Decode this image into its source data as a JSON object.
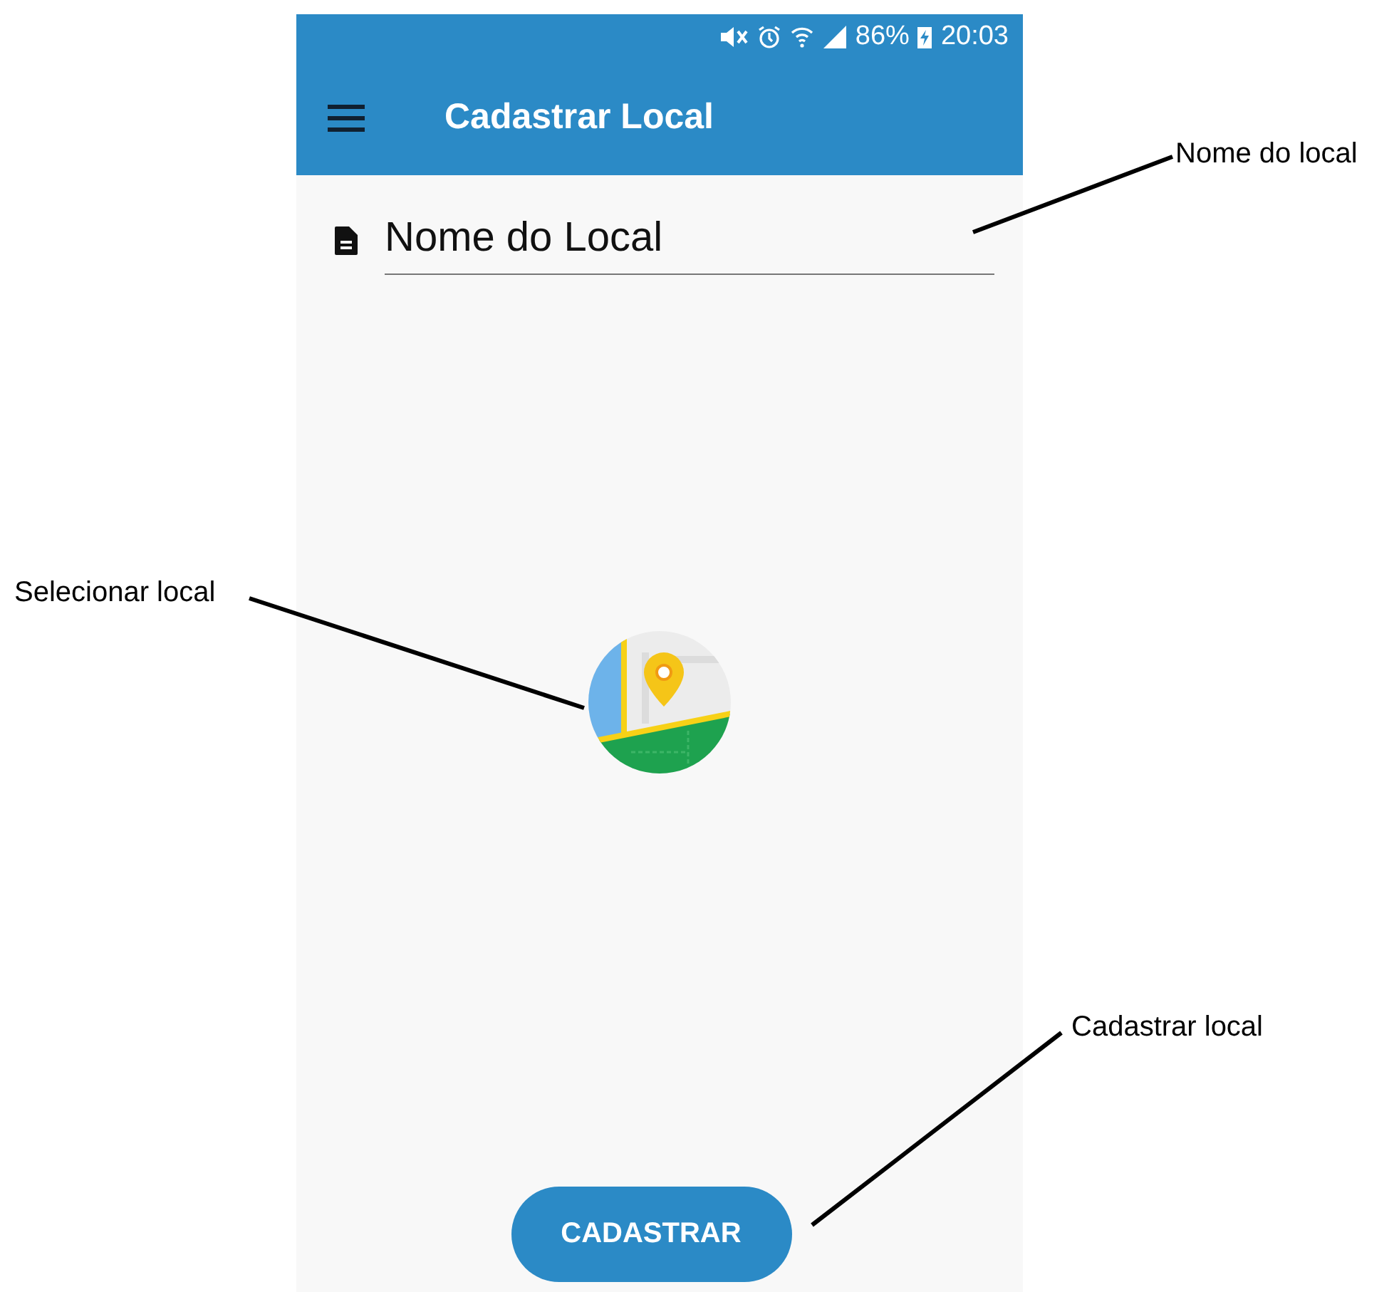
{
  "status_bar": {
    "battery": "86%",
    "time": "20:03"
  },
  "app_bar": {
    "title": "Cadastrar Local"
  },
  "name_field": {
    "placeholder": "Nome do Local"
  },
  "button": {
    "label": "CADASTRAR"
  },
  "annotations": [
    {
      "text": "Nome do local"
    },
    {
      "text": "Selecionar local"
    },
    {
      "text": "Cadastrar local"
    }
  ]
}
